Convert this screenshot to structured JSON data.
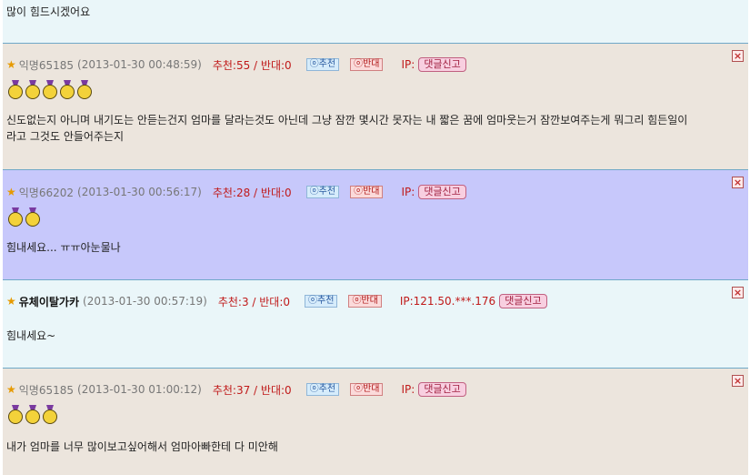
{
  "top_comment": {
    "text": "많이 힘드시겠어요"
  },
  "labels": {
    "recommend": "ⓞ추천",
    "oppose": "ⓞ반대",
    "report": "댓글신고",
    "close": "×"
  },
  "comments": [
    {
      "nick": "익명65185",
      "date": "(2013-01-30 00:48:59)",
      "votes": "추천:55 / 반대:0",
      "ip": "IP:",
      "medals": 5,
      "lines": [
        "신도없는지 아니며 내기도는 안듣는건지 엄마를 달라는것도 아닌데 그냥 잠깐 몇시간 못자는 내 짧은 꿈에 엄마웃는거 잠깐보여주는게 뭐그리 힘든일이",
        "라고 그것도 안들어주는지"
      ]
    },
    {
      "nick": "익명66202",
      "date": "(2013-01-30 00:56:17)",
      "votes": "추천:28 / 반대:0",
      "ip": "IP:",
      "medals": 2,
      "lines": [
        "힘내세요... ㅠㅠ아눈물나"
      ]
    },
    {
      "nick": "유체이탈가카",
      "date": "(2013-01-30 00:57:19)",
      "votes": "추천:3 / 반대:0",
      "ip": "IP:121.50.***.176",
      "medals": 0,
      "lines": [
        "힘내세요~"
      ]
    },
    {
      "nick": "익명65185",
      "date": "(2013-01-30 01:00:12)",
      "votes": "추천:37 / 반대:0",
      "ip": "IP:",
      "medals": 3,
      "lines": [
        "내가 엄마를 너무 많이보고싶어해서 엄마아빠한테 다 미안해"
      ]
    }
  ]
}
